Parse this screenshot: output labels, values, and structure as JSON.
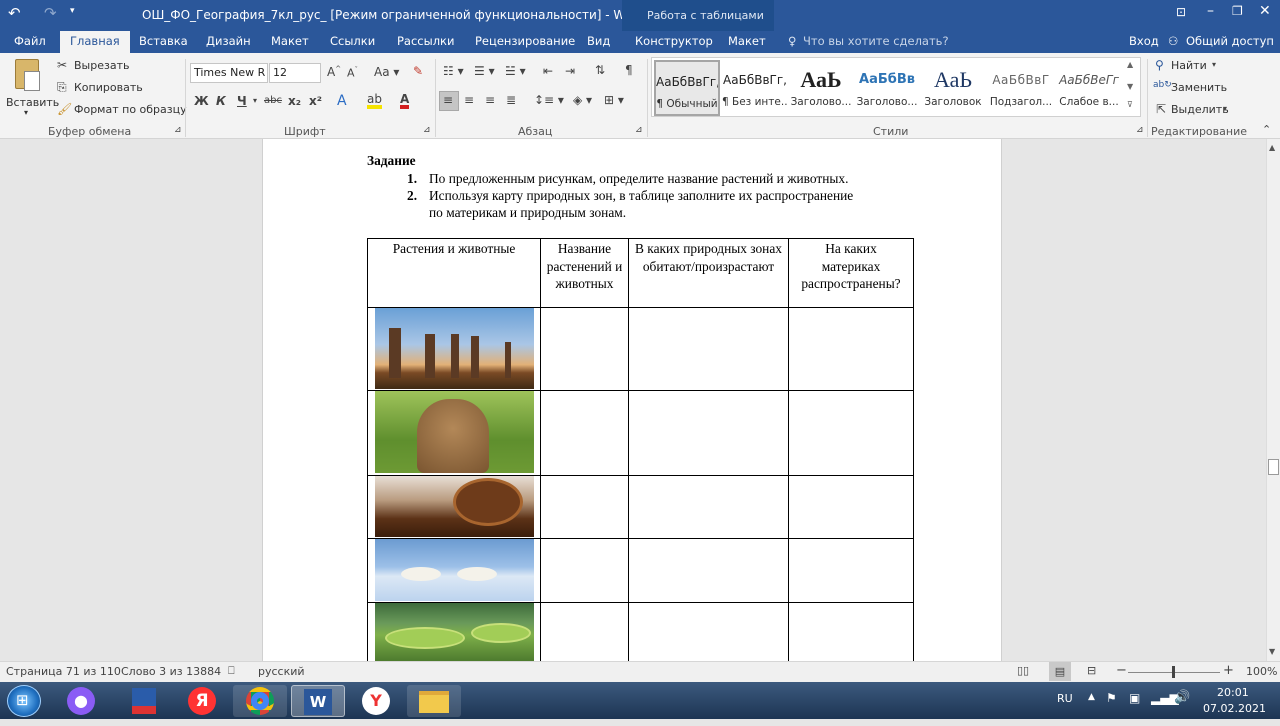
{
  "window": {
    "title": "ОШ_ФО_География_7кл_рус_ [Режим ограниченной функциональности] - Word",
    "context_tab_group": "Работа с таблицами"
  },
  "tabs": [
    "Файл",
    "Главная",
    "Вставка",
    "Дизайн",
    "Макет",
    "Ссылки",
    "Рассылки",
    "Рецензирование",
    "Вид",
    "Конструктор",
    "Макет"
  ],
  "tell_me": "Что вы хотите сделать?",
  "account": {
    "signin": "Вход",
    "share": "Общий доступ"
  },
  "clipboard": {
    "paste": "Вставить",
    "cut": "Вырезать",
    "copy": "Копировать",
    "format_painter": "Формат по образцу",
    "label": "Буфер обмена"
  },
  "font": {
    "name": "Times New R",
    "size": "12",
    "label": "Шрифт",
    "bold": "Ж",
    "italic": "К",
    "underline": "Ч",
    "strike": "abc",
    "sub": "x₂",
    "sup": "x²"
  },
  "paragraph": {
    "label": "Абзац"
  },
  "styles": {
    "label": "Стили",
    "items": [
      {
        "preview": "АаБбВвГг,",
        "name": "¶ Обычный"
      },
      {
        "preview": "АаБбВвГг,",
        "name": "¶ Без инте..."
      },
      {
        "preview": "АаЬ",
        "name": "Заголово..."
      },
      {
        "preview": "АаБбВв",
        "name": "Заголово..."
      },
      {
        "preview": "АаЬ",
        "name": "Заголовок"
      },
      {
        "preview": "АаБбВвГ",
        "name": "Подзагол..."
      },
      {
        "preview": "АаБбВеГг",
        "name": "Слабое в..."
      }
    ]
  },
  "editing": {
    "find": "Найти",
    "replace": "Заменить",
    "select": "Выделить",
    "label": "Редактирование"
  },
  "document": {
    "heading": "Задание",
    "items": [
      {
        "num": "1.",
        "text": "По  предложенным рисункам, определите название растений  и животных."
      },
      {
        "num": "2.",
        "text": "Используя карту природных зон, в таблице заполните их распространение",
        "text2": "по материкам  и  природным зонам."
      }
    ],
    "table": {
      "headers": [
        "Растения и животные",
        "Название растенений и животных",
        "В каких природных зонах обитают/произрастают",
        "На каких материках распространены?"
      ],
      "rows": [
        {
          "image": "baobab-trees"
        },
        {
          "image": "groundhog"
        },
        {
          "image": "cocoa-beans"
        },
        {
          "image": "polar-bears"
        },
        {
          "image": "victoria-water-lily"
        }
      ]
    }
  },
  "status": {
    "page": "Страница 71 из 110",
    "words": "Слово 3 из 13884",
    "language": "русский",
    "zoom": "100%"
  },
  "taskbar": {
    "lang": "RU",
    "time": "20:01",
    "date": "07.02.2021"
  }
}
